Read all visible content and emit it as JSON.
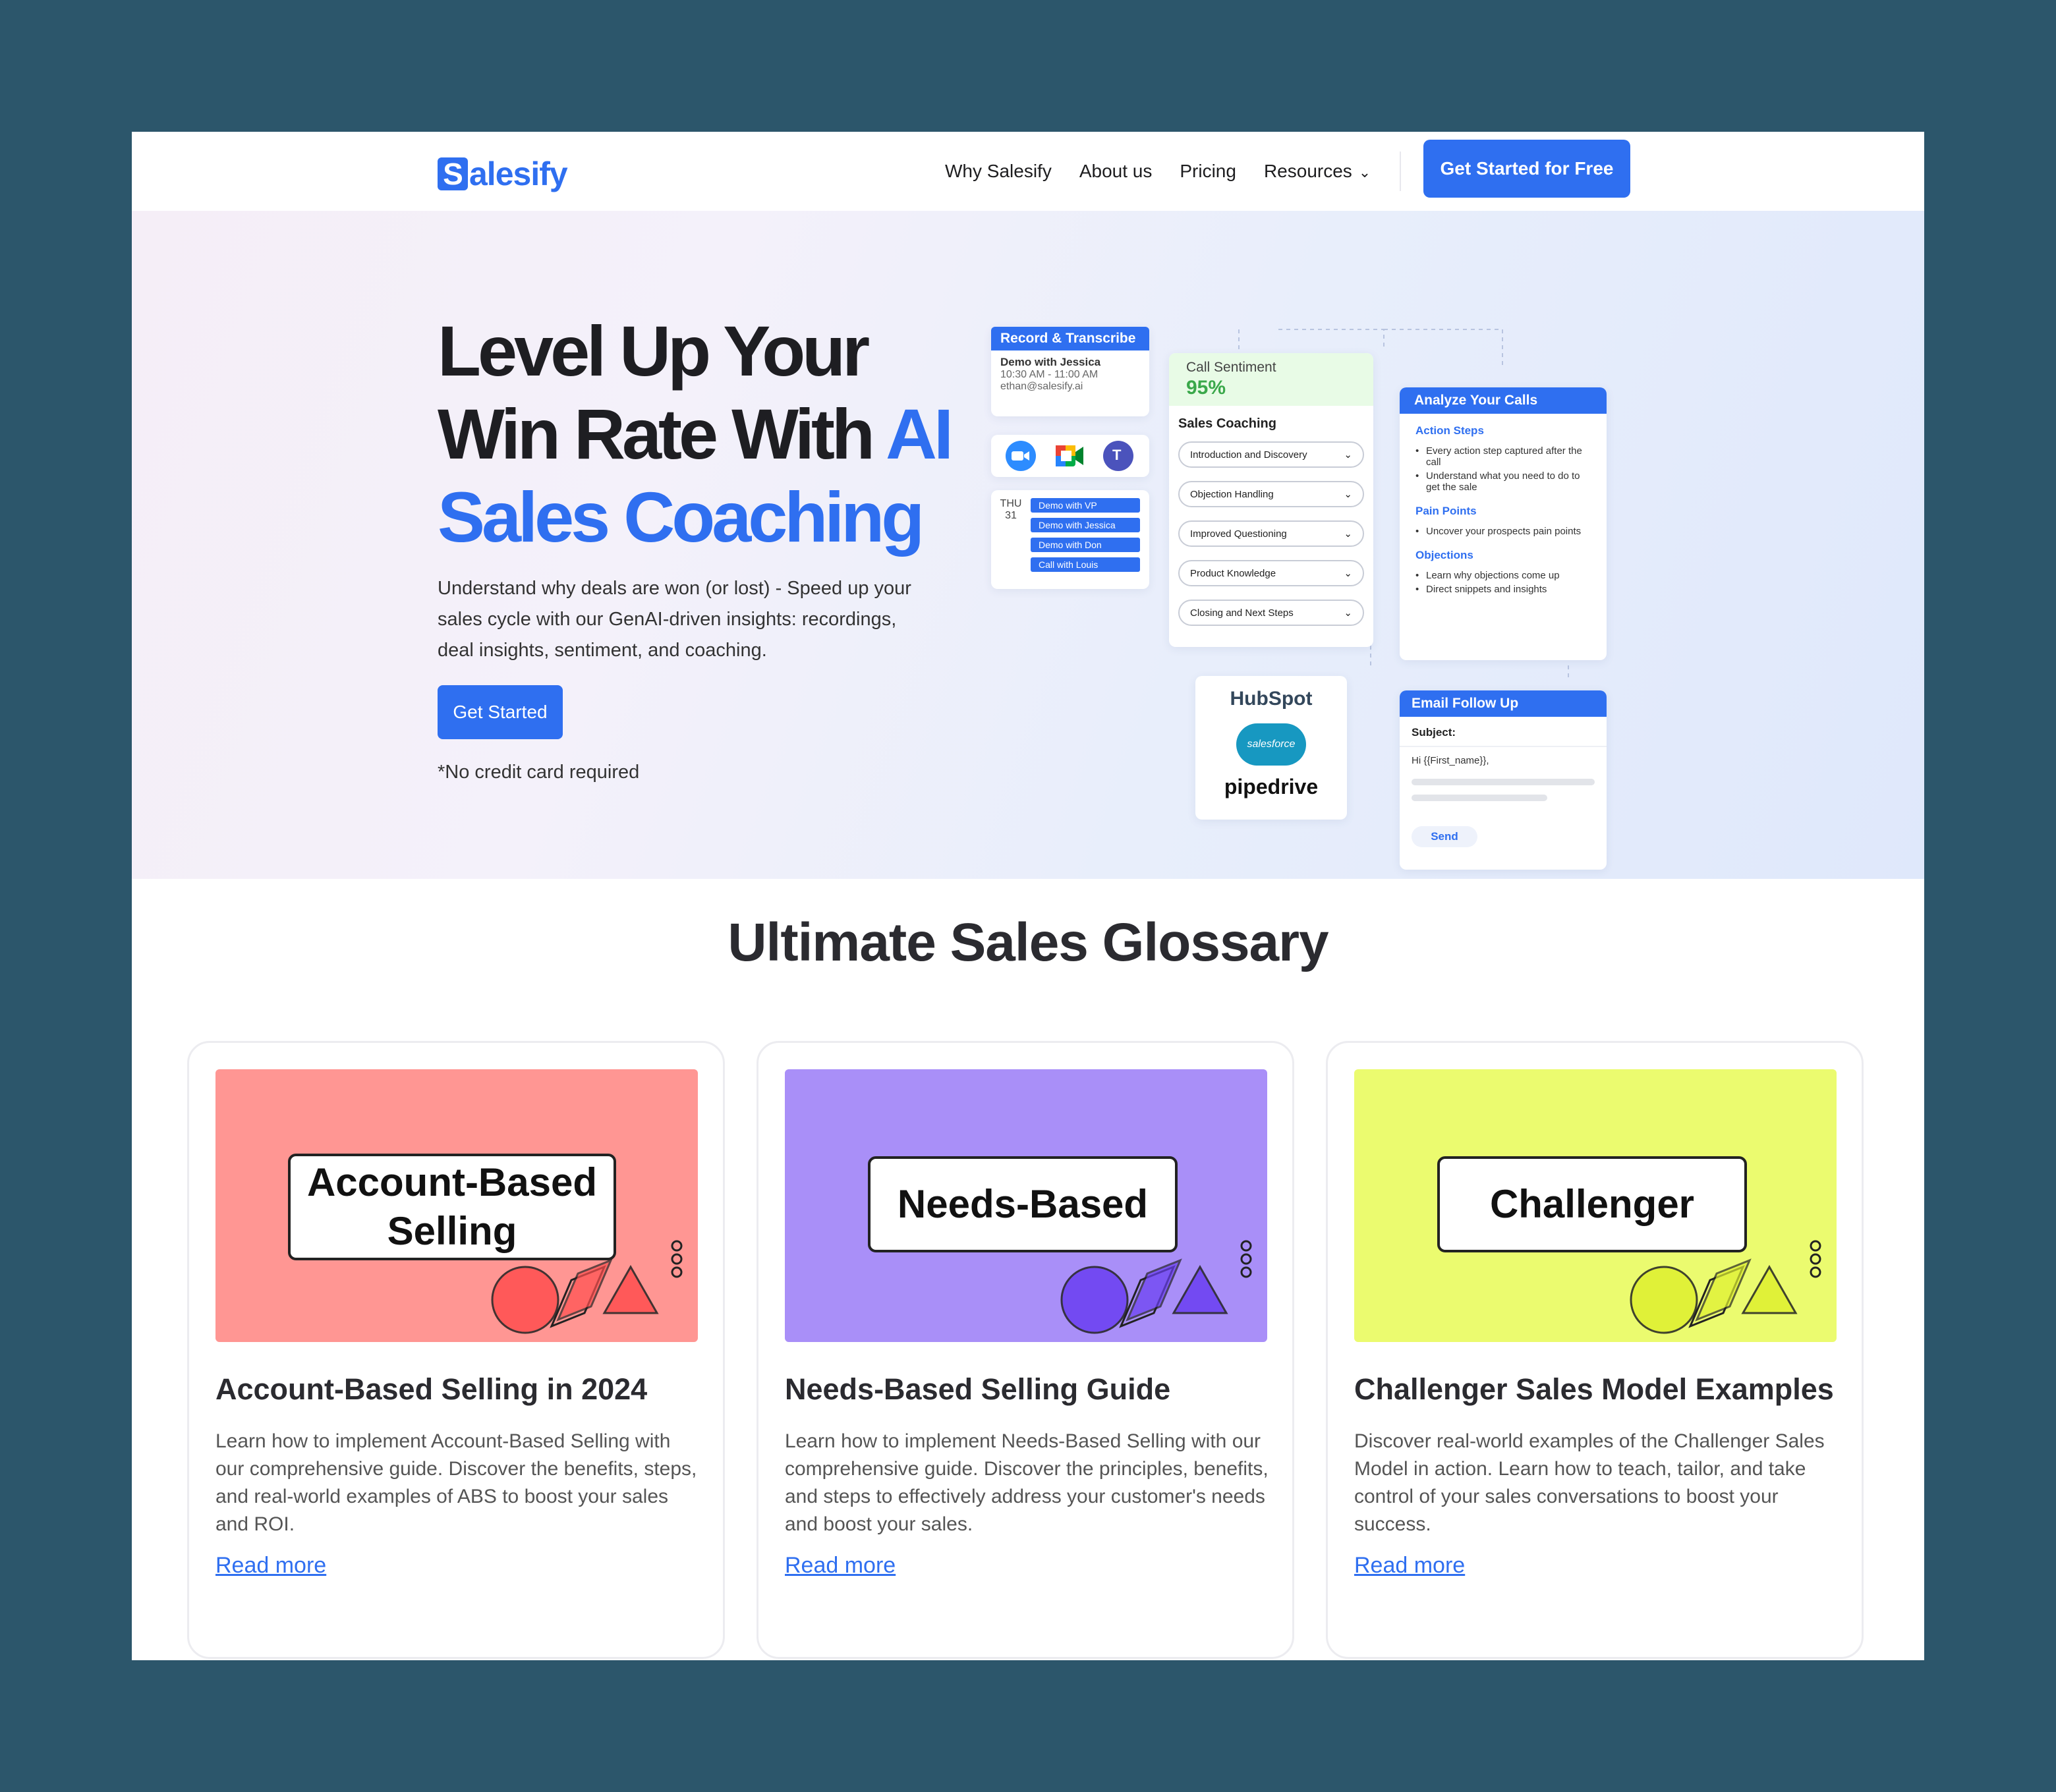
{
  "nav": {
    "logo_letter": "S",
    "logo_rest": "alesify",
    "links": [
      "Why Salesify",
      "About us",
      "Pricing",
      "Resources"
    ],
    "cta": "Get Started for Free"
  },
  "hero": {
    "title_line1": "Level Up Your",
    "title_line2_dark": "Win Rate With ",
    "title_line2_blue": "AI",
    "title_line3": "Sales Coaching",
    "subtitle": "Understand why deals are won (or lost) - Speed up your sales cycle with our GenAI-driven insights: recordings, deal insights, sentiment, and coaching.",
    "button": "Get Started",
    "note": "*No credit card required"
  },
  "mock": {
    "record": {
      "header": "Record & Transcribe",
      "name": "Demo with Jessica",
      "time": "10:30 AM - 11:00 AM",
      "email": "ethan@salesify.ai"
    },
    "calendar": {
      "day": "THU",
      "date": "31",
      "events": [
        "Demo with VP",
        "Demo with Jessica",
        "Demo with Don",
        "Call with Louis"
      ]
    },
    "sentiment": {
      "label": "Call Sentiment",
      "value": "95%"
    },
    "coaching": {
      "title": "Sales Coaching",
      "items": [
        "Introduction and Discovery",
        "Objection Handling",
        "Improved Questioning",
        "Product Knowledge",
        "Closing and Next Steps"
      ]
    },
    "analyze": {
      "header": "Analyze Your Calls",
      "sections": [
        {
          "title": "Action Steps",
          "bullets": [
            "Every action step captured after the call",
            "Understand what you need to do to get the sale"
          ]
        },
        {
          "title": "Pain Points",
          "bullets": [
            "Uncover your prospects pain points"
          ]
        },
        {
          "title": "Objections",
          "bullets": [
            "Learn why objections come up",
            "Direct snippets and insights"
          ]
        }
      ]
    },
    "crm": [
      "HubSpot",
      "salesforce",
      "pipedrive"
    ],
    "email": {
      "header": "Email Follow Up",
      "subject": "Subject:",
      "greeting": "Hi {{First_name}},",
      "send": "Send"
    }
  },
  "glossary": {
    "title": "Ultimate Sales Glossary",
    "cards": [
      {
        "image_label": "Account-Based Selling",
        "title": "Account-Based Selling in 2024",
        "desc": "Learn how to implement Account-Based Selling with our comprehensive guide. Discover the benefits, steps, and real-world examples of ABS to boost your sales and ROI.",
        "link": "Read more",
        "bg": "#ff9693",
        "shape": "#ff4f4f"
      },
      {
        "image_label": "Needs-Based",
        "title": "Needs-Based Selling Guide",
        "desc": "Learn how to implement Needs-Based Selling with our comprehensive guide. Discover the principles, benefits, and steps to effectively address your customer's needs and boost your sales.",
        "link": "Read more",
        "bg": "#a98ff8",
        "shape": "#6a3ef2"
      },
      {
        "image_label": "Challenger",
        "title": "Challenger Sales Model Examples",
        "desc": "Discover real-world examples of the Challenger Sales Model in action. Learn how to teach, tailor, and take control of your sales conversations to boost your success.",
        "link": "Read more",
        "bg": "#ebfb6f",
        "shape": "#dff02f"
      }
    ]
  },
  "colors": {
    "accent": "#2f6ff0",
    "outer_bg": "#2c566b"
  }
}
